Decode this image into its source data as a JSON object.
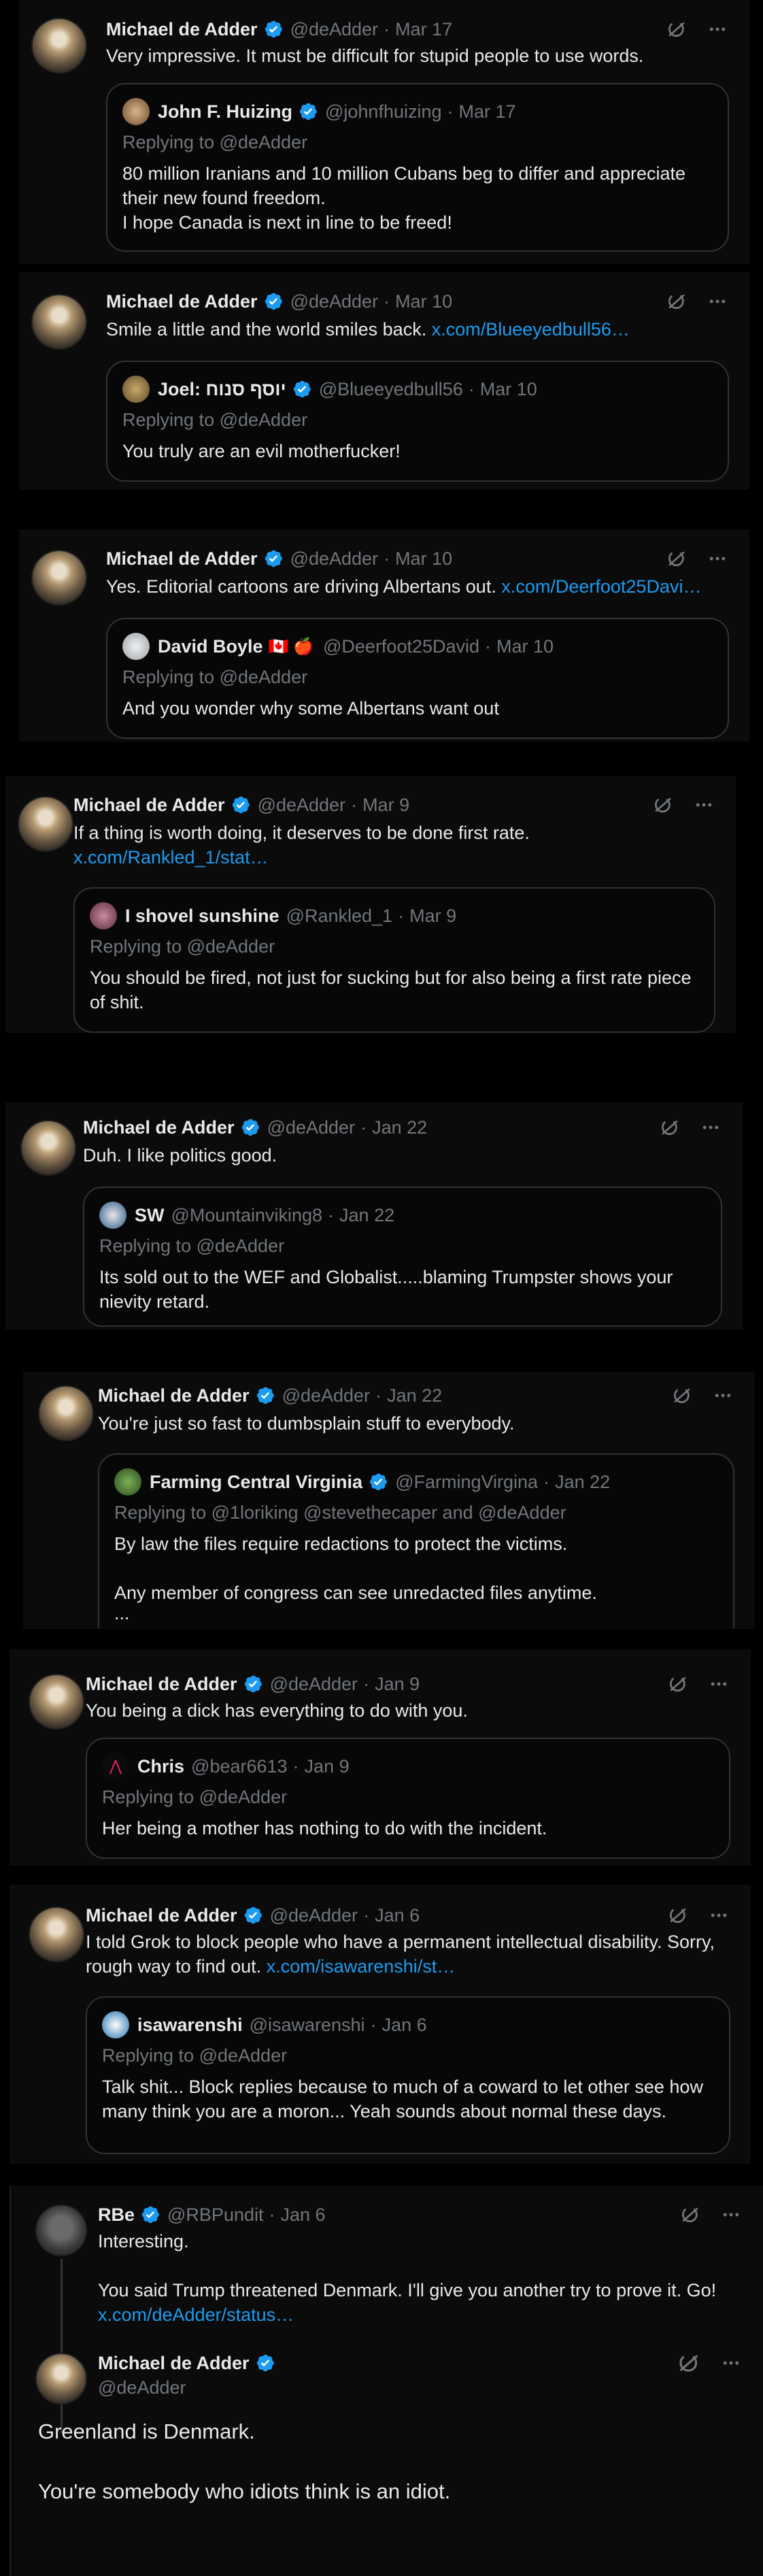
{
  "icons": {
    "verified": "verified-badge-icon",
    "grok": "grok-icon",
    "more": "more-icon"
  },
  "colors": {
    "link": "#1d9bf0",
    "verified": "#1d9bf0",
    "muted": "#71767b",
    "text": "#e7e9ea"
  },
  "posts": [
    {
      "name": "Michael de Adder",
      "handle": "@deAdder",
      "dot": "·",
      "date": "Mar 17",
      "text": "Very impressive. It must be difficult for stupid people to use words.",
      "quote": {
        "name": "John F. Huizing",
        "handle": "@johnfhuizing",
        "dot": "·",
        "date": "Mar 17",
        "replying": "Replying to @deAdder",
        "line1": "80 million Iranians and 10 million Cubans beg to differ and appreciate their new found freedom.",
        "line2": "I hope Canada is next in line to be freed!"
      }
    },
    {
      "name": "Michael de Adder",
      "handle": "@deAdder",
      "dot": "·",
      "date": "Mar 10",
      "text": "Smile a little and the world smiles back.",
      "link": "x.com/Blueeyedbull56…",
      "quote": {
        "name": "Joel: יוסף סנוח",
        "handle": "@Blueeyedbull56",
        "dot": "·",
        "date": "Mar 10",
        "replying": "Replying to @deAdder",
        "line1": "You truly are an evil motherfucker!"
      }
    },
    {
      "name": "Michael de Adder",
      "handle": "@deAdder",
      "dot": "·",
      "date": "Mar 10",
      "text": "Yes. Editorial cartoons are driving Albertans out.",
      "link": "x.com/Deerfoot25Davi…",
      "quote": {
        "name": "David Boyle",
        "flags": "🇨🇦 🍎",
        "handle": "@Deerfoot25David",
        "dot": "·",
        "date": "Mar 10",
        "replying": "Replying to @deAdder",
        "line1": "And you wonder why some Albertans want out"
      }
    },
    {
      "name": "Michael de Adder",
      "handle": "@deAdder",
      "dot": "·",
      "date": "Mar 9",
      "text": "If a thing is worth doing, it deserves to be done first rate.",
      "link": "x.com/Rankled_1/stat…",
      "quote": {
        "name": "I shovel sunshine",
        "handle": "@Rankled_1",
        "dot": "·",
        "date": "Mar 9",
        "replying": "Replying to @deAdder",
        "line1": "You should be fired, not just for sucking but for also being a first rate piece of shit."
      }
    },
    {
      "name": "Michael de Adder",
      "handle": "@deAdder",
      "dot": "·",
      "date": "Jan 22",
      "text": "Duh. I like politics good.",
      "quote": {
        "name": "SW",
        "handle": "@Mountainviking8",
        "dot": "·",
        "date": "Jan 22",
        "replying": "Replying to @deAdder",
        "line1": "Its sold out to the WEF and Globalist.....blaming Trumpster shows your nievity retard."
      }
    },
    {
      "name": "Michael de Adder",
      "handle": "@deAdder",
      "dot": "·",
      "date": "Jan 22",
      "text": "You're just so fast to dumbsplain stuff to everybody.",
      "quote": {
        "name": "Farming Central Virginia",
        "handle": "@FarmingVirgina",
        "dot": "·",
        "date": "Jan 22",
        "replying": "Replying to @1loriking @stevethecaper and @deAdder",
        "line1": "By law the files require redactions to protect the victims.",
        "line2": "Any member of congress can see unredacted files anytime.",
        "line3": "..."
      }
    },
    {
      "name": "Michael de Adder",
      "handle": "@deAdder",
      "dot": "·",
      "date": "Jan 9",
      "text": "You being a dick has everything to do with you.",
      "quote": {
        "name": "Chris",
        "handle": "@bear6613",
        "dot": "·",
        "date": "Jan 9",
        "replying": "Replying to @deAdder",
        "line1": "Her being a mother has nothing to do with the incident."
      }
    },
    {
      "name": "Michael de Adder",
      "handle": "@deAdder",
      "dot": "·",
      "date": "Jan 6",
      "text": "I told Grok to block people who have a permanent intellectual disability. Sorry, rough way to find out.",
      "link": "x.com/isawarenshi/st…",
      "quote": {
        "name": "isawarenshi",
        "handle": "@isawarenshi",
        "dot": "·",
        "date": "Jan 6",
        "replying": "Replying to @deAdder",
        "line1": "Talk shit... Block replies because to much of a coward to let other see how many think you are a moron... Yeah sounds about normal these days."
      }
    }
  ],
  "thread": {
    "parent": {
      "name": "RBe",
      "handle": "@RBPundit",
      "dot": "·",
      "date": "Jan 6",
      "line1": "Interesting.",
      "line2": "You said Trump threatened Denmark. I'll give you another try to prove it. Go!",
      "link": "x.com/deAdder/status…"
    },
    "reply": {
      "name": "Michael de Adder",
      "handle": "@deAdder",
      "line1": "Greenland is Denmark.",
      "line2": "You're somebody who idiots think is an idiot."
    }
  }
}
